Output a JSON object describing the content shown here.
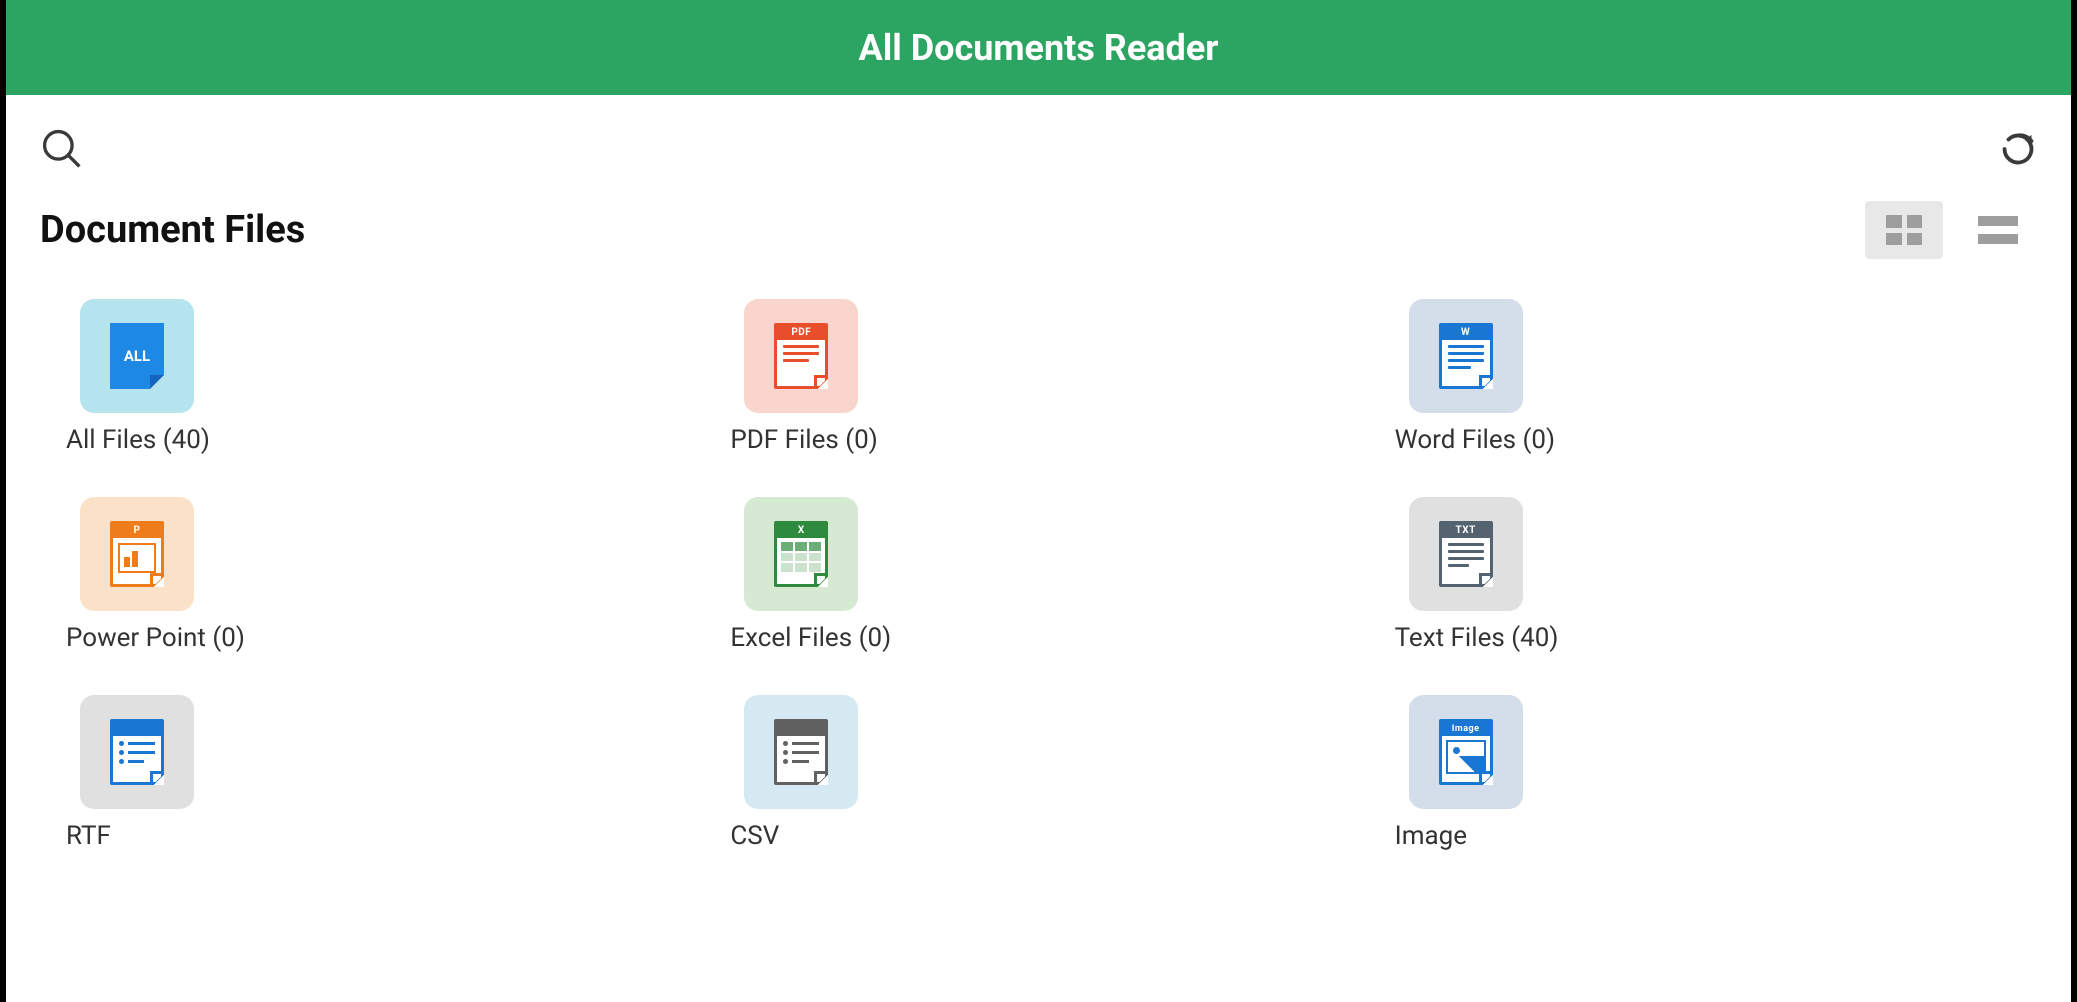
{
  "header": {
    "title": "All Documents Reader"
  },
  "icons": {
    "search": "search-icon",
    "refresh": "refresh-icon",
    "grid_view": "grid-view-icon",
    "list_view": "list-view-icon"
  },
  "section": {
    "title": "Document Files"
  },
  "view": {
    "active": "grid"
  },
  "categories": [
    {
      "key": "all",
      "label": "All Files (40)",
      "icon_text": "ALL",
      "bg": "bg-all",
      "doc_class": ""
    },
    {
      "key": "pdf",
      "label": "PDF Files (0)",
      "icon_text": "PDF",
      "bg": "bg-pdf",
      "doc_class": "doc-pdf"
    },
    {
      "key": "word",
      "label": "Word Files (0)",
      "icon_text": "W",
      "bg": "bg-word",
      "doc_class": "doc-word"
    },
    {
      "key": "ppt",
      "label": "Power Point (0)",
      "icon_text": "P",
      "bg": "bg-ppt",
      "doc_class": "doc-ppt"
    },
    {
      "key": "excel",
      "label": "Excel Files (0)",
      "icon_text": "X",
      "bg": "bg-excel",
      "doc_class": "doc-excel"
    },
    {
      "key": "txt",
      "label": "Text Files (40)",
      "icon_text": "TXT",
      "bg": "bg-txt",
      "doc_class": "doc-txt"
    },
    {
      "key": "rtf",
      "label": "RTF",
      "icon_text": "",
      "bg": "bg-rtf",
      "doc_class": "doc-rtf"
    },
    {
      "key": "csv",
      "label": "CSV",
      "icon_text": "",
      "bg": "bg-csv",
      "doc_class": "doc-csv"
    },
    {
      "key": "image",
      "label": "Image",
      "icon_text": "Image",
      "bg": "bg-image",
      "doc_class": "doc-image"
    }
  ],
  "colors": {
    "primary": "#2DA562",
    "pdf": "#E94E2B",
    "word": "#1976D2",
    "ppt": "#EF7C1A",
    "excel": "#2E8B3D",
    "txt": "#556270"
  }
}
